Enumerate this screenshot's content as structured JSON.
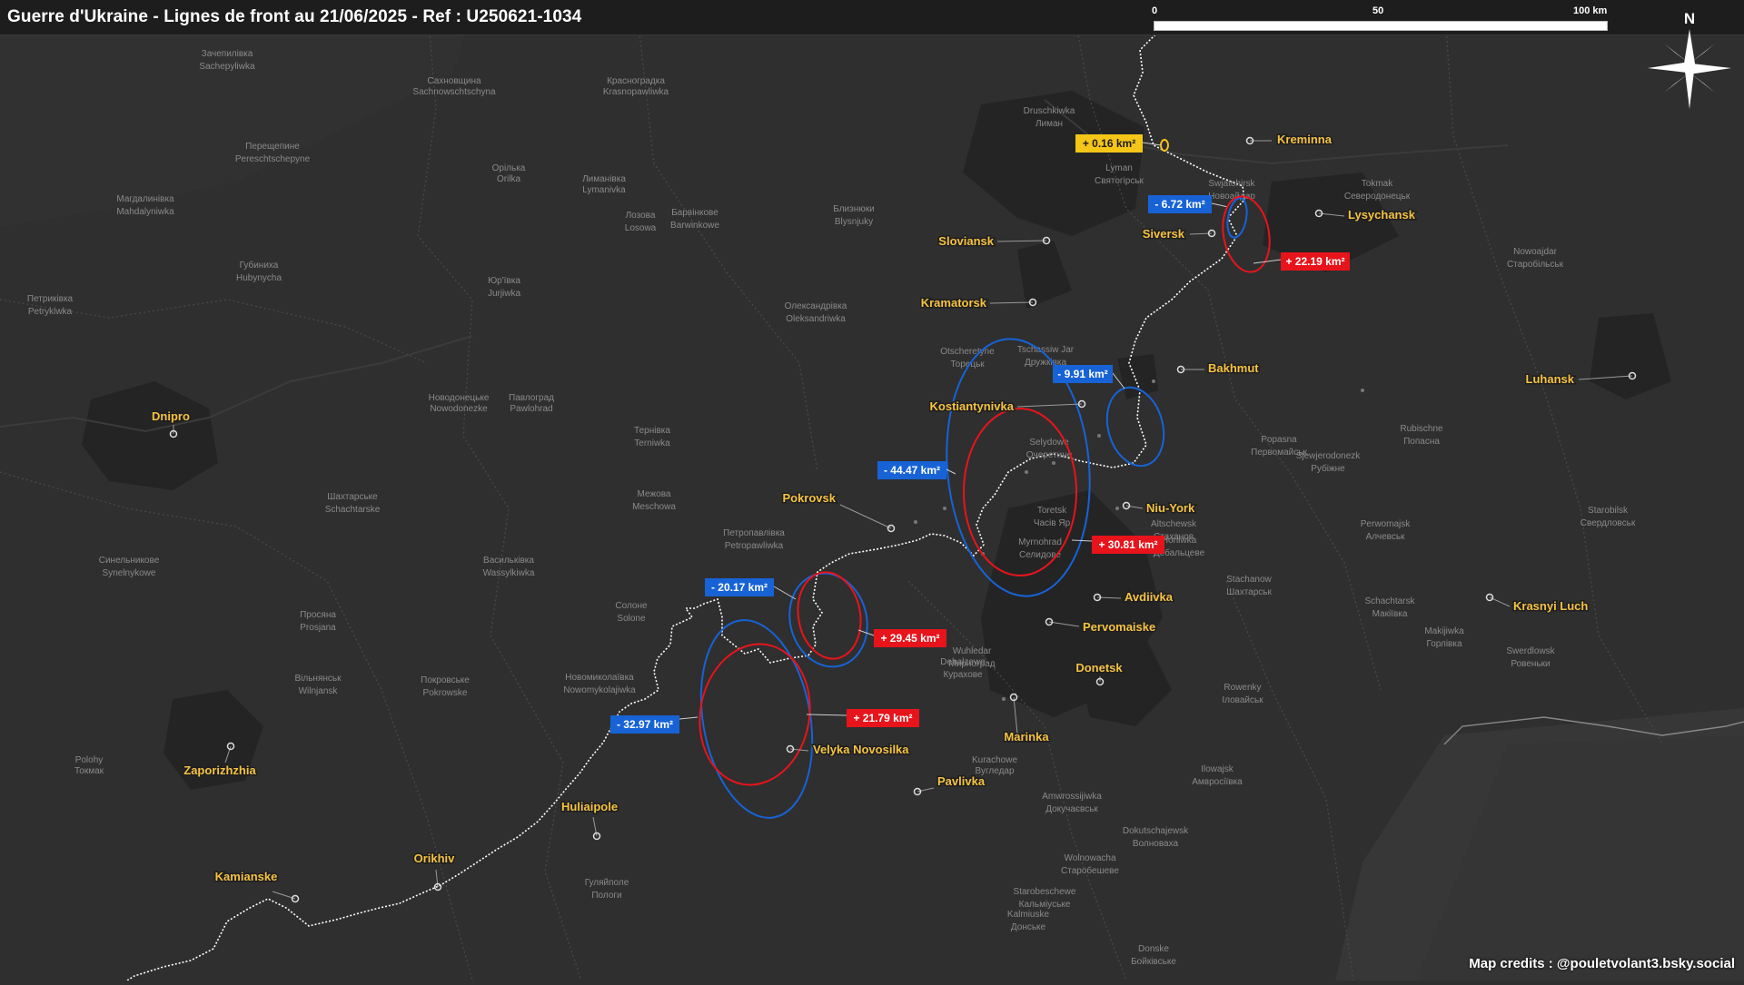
{
  "title": "Guerre d'Ukraine - Lignes de front au 21/06/2025 - Ref : U250621-1034",
  "scale": {
    "labels": [
      "0",
      "50",
      "100 km"
    ]
  },
  "north_arrow": {
    "label": "N"
  },
  "credits": "Map credits : @pouletvolant3.bsky.social",
  "colors": {
    "background": "#2f2f2f",
    "front_line": "#ffffff",
    "city_label": "#f5c242",
    "gain": "#e8141b",
    "loss": "#1763d6",
    "minor": "#f5c518"
  },
  "cities": [
    {
      "name": "Kreminna"
    },
    {
      "name": "Lysychansk"
    },
    {
      "name": "Siversk"
    },
    {
      "name": "Sloviansk"
    },
    {
      "name": "Kramatorsk"
    },
    {
      "name": "Bakhmut"
    },
    {
      "name": "Luhansk"
    },
    {
      "name": "Kostiantynivka"
    },
    {
      "name": "Dnipro"
    },
    {
      "name": "Pokrovsk"
    },
    {
      "name": "Niu-York"
    },
    {
      "name": "Avdiivka"
    },
    {
      "name": "Pervomaiske"
    },
    {
      "name": "Donetsk"
    },
    {
      "name": "Krasnyi Luch"
    },
    {
      "name": "Marinka"
    },
    {
      "name": "Zaporizhzhia"
    },
    {
      "name": "Velyka Novosilka"
    },
    {
      "name": "Pavlivka"
    },
    {
      "name": "Huliaipole"
    },
    {
      "name": "Orikhiv"
    },
    {
      "name": "Kamianske"
    }
  ],
  "area_changes": [
    {
      "label": "+ 0.16 km²",
      "kind": "minor"
    },
    {
      "label": "- 6.72 km²",
      "kind": "loss"
    },
    {
      "label": "+ 22.19 km²",
      "kind": "gain"
    },
    {
      "label": "- 9.91 km²",
      "kind": "loss"
    },
    {
      "label": "- 44.47 km²",
      "kind": "loss"
    },
    {
      "label": "+ 30.81 km²",
      "kind": "gain"
    },
    {
      "label": "- 20.17 km²",
      "kind": "loss"
    },
    {
      "label": "+ 29.45 km²",
      "kind": "gain"
    },
    {
      "label": "- 32.97 km²",
      "kind": "loss"
    },
    {
      "label": "+ 21.79 km²",
      "kind": "gain"
    }
  ],
  "place_names": [
    "Зачепилівка",
    "Sachepyliwka",
    "Сахновщина",
    "Sachnowschtschyna",
    "Красноградка",
    "Krasnopawliwka",
    "Перещепине",
    "Pereschtschepyne",
    "Орілька",
    "Orilka",
    "Лиманівка",
    "Lymanivka",
    "Лозова",
    "Losowa",
    "Магдалинівка",
    "Mahdalyniwka",
    "Близнюки",
    "Blysnjuky",
    "Барвінкове",
    "Barwinkowe",
    "Губиниха",
    "Hubynycha",
    "Петриківка",
    "Petrykiwka",
    "Юр'ївка",
    "Jurjiwka",
    "Олександрівка",
    "Oleksandriwka",
    "Новодонецьке",
    "Nowodonezke",
    "Павлоград",
    "Pawlohrad",
    "Тернівка",
    "Terniwka",
    "Петропавлівка",
    "Petropawliwka",
    "Межова",
    "Meschowa",
    "Шахтарське",
    "Schachtarske",
    "Синельникове",
    "Synelnykowe",
    "Васильківка",
    "Wassylkiwka",
    "Солоне",
    "Solone",
    "Просяна",
    "Prosjana",
    "Покровське",
    "Pokrowske",
    "Новомиколаївка",
    "Nowomykolajiwka",
    "Вільнянськ",
    "Wilnjansk",
    "Гуляйполе",
    "Пологи",
    "Polohy",
    "Токмак",
    "Tokmak",
    "Северодонецьк",
    "Sjewjerodonezk",
    "Рубіжне",
    "Rubischne",
    "Попасна",
    "Popasna",
    "Первомайськ",
    "Perwomajsk",
    "Алчевськ",
    "Altschewsk",
    "Стаханов",
    "Stachanow",
    "Шахтарськ",
    "Schachtarsk",
    "Макіївка",
    "Makijiwka",
    "Горлівка",
    "Horliwka",
    "Дебальцеве",
    "Debalzewe",
    "Курахове",
    "Kurachowe",
    "Вугледар",
    "Wuhledar",
    "Мирноград",
    "Myrnohrad",
    "Селидове",
    "Selydowe",
    "Очеретине",
    "Otscheretyne",
    "Торецьк",
    "Toretsk",
    "Часів Яр",
    "Tschassiw Jar",
    "Дружківка",
    "Druschkiwka",
    "Лиман",
    "Lyman",
    "Святогірськ",
    "Swjatohirsk",
    "Новоайдар",
    "Nowoajdar",
    "Старобільськ",
    "Starobilsk",
    "Свердловськ",
    "Swerdlowsk",
    "Ровеньки",
    "Rowenky",
    "Іловайськ",
    "Ilowajsk",
    "Амвросіївка",
    "Amwrossijiwka",
    "Докучаєвськ",
    "Dokutschajewsk",
    "Волноваха",
    "Wolnowacha",
    "Старобешеве",
    "Starobeschewe",
    "Кальміуське",
    "Kalmiuske",
    "Донське",
    "Donske",
    "Бойківське",
    "Boikivske"
  ]
}
